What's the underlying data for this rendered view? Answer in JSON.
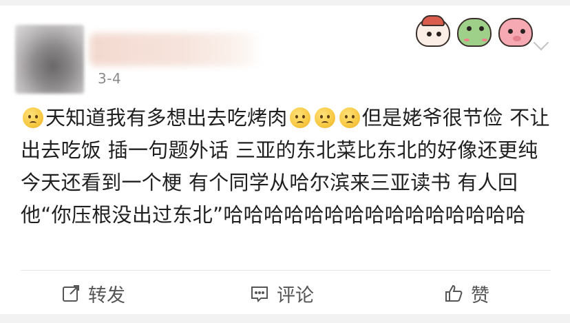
{
  "post": {
    "date": "3-4",
    "text_segments": [
      "天知道我有多想出去吃烤肉",
      "但是姥爷很节俭 不让出去吃饭 插一句题外话 三亚的东北菜比东北的好像还更纯   今天还看到一个梗 有个同学从哈尔滨来三亚读书 有人回他“你压根没出过东北”哈哈哈哈哈哈哈哈哈哈哈哈哈哈哈"
    ],
    "emoji": [
      "sad-face-emoji",
      "sad-face-emoji",
      "sad-face-emoji",
      "sad-face-emoji"
    ]
  },
  "stickers": [
    "bird-sticker",
    "frog-sticker",
    "pig-sticker"
  ],
  "actions": {
    "repost_label": "转发",
    "comment_label": "评论",
    "like_label": "赞"
  },
  "colors": {
    "page_bg": "#f2f2f2",
    "card_bg": "#ffffff",
    "text": "#1f1f1f",
    "meta": "#8a8a8a",
    "action": "#555555"
  }
}
